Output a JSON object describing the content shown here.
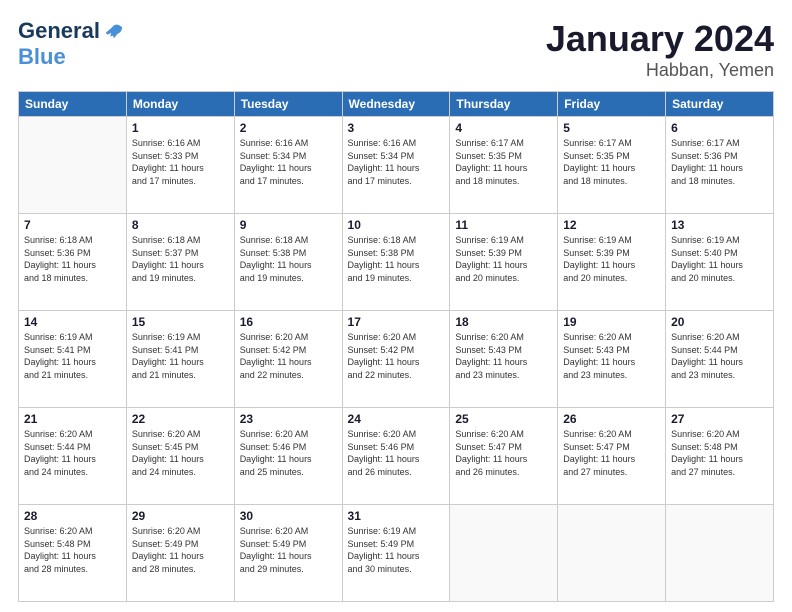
{
  "header": {
    "logo": {
      "general": "General",
      "blue": "Blue"
    },
    "title": "January 2024",
    "location": "Habban, Yemen"
  },
  "calendar": {
    "days_of_week": [
      "Sunday",
      "Monday",
      "Tuesday",
      "Wednesday",
      "Thursday",
      "Friday",
      "Saturday"
    ],
    "weeks": [
      [
        {
          "day": "",
          "info": ""
        },
        {
          "day": "1",
          "info": "Sunrise: 6:16 AM\nSunset: 5:33 PM\nDaylight: 11 hours\nand 17 minutes."
        },
        {
          "day": "2",
          "info": "Sunrise: 6:16 AM\nSunset: 5:34 PM\nDaylight: 11 hours\nand 17 minutes."
        },
        {
          "day": "3",
          "info": "Sunrise: 6:16 AM\nSunset: 5:34 PM\nDaylight: 11 hours\nand 17 minutes."
        },
        {
          "day": "4",
          "info": "Sunrise: 6:17 AM\nSunset: 5:35 PM\nDaylight: 11 hours\nand 18 minutes."
        },
        {
          "day": "5",
          "info": "Sunrise: 6:17 AM\nSunset: 5:35 PM\nDaylight: 11 hours\nand 18 minutes."
        },
        {
          "day": "6",
          "info": "Sunrise: 6:17 AM\nSunset: 5:36 PM\nDaylight: 11 hours\nand 18 minutes."
        }
      ],
      [
        {
          "day": "7",
          "info": "Sunrise: 6:18 AM\nSunset: 5:36 PM\nDaylight: 11 hours\nand 18 minutes."
        },
        {
          "day": "8",
          "info": "Sunrise: 6:18 AM\nSunset: 5:37 PM\nDaylight: 11 hours\nand 19 minutes."
        },
        {
          "day": "9",
          "info": "Sunrise: 6:18 AM\nSunset: 5:38 PM\nDaylight: 11 hours\nand 19 minutes."
        },
        {
          "day": "10",
          "info": "Sunrise: 6:18 AM\nSunset: 5:38 PM\nDaylight: 11 hours\nand 19 minutes."
        },
        {
          "day": "11",
          "info": "Sunrise: 6:19 AM\nSunset: 5:39 PM\nDaylight: 11 hours\nand 20 minutes."
        },
        {
          "day": "12",
          "info": "Sunrise: 6:19 AM\nSunset: 5:39 PM\nDaylight: 11 hours\nand 20 minutes."
        },
        {
          "day": "13",
          "info": "Sunrise: 6:19 AM\nSunset: 5:40 PM\nDaylight: 11 hours\nand 20 minutes."
        }
      ],
      [
        {
          "day": "14",
          "info": "Sunrise: 6:19 AM\nSunset: 5:41 PM\nDaylight: 11 hours\nand 21 minutes."
        },
        {
          "day": "15",
          "info": "Sunrise: 6:19 AM\nSunset: 5:41 PM\nDaylight: 11 hours\nand 21 minutes."
        },
        {
          "day": "16",
          "info": "Sunrise: 6:20 AM\nSunset: 5:42 PM\nDaylight: 11 hours\nand 22 minutes."
        },
        {
          "day": "17",
          "info": "Sunrise: 6:20 AM\nSunset: 5:42 PM\nDaylight: 11 hours\nand 22 minutes."
        },
        {
          "day": "18",
          "info": "Sunrise: 6:20 AM\nSunset: 5:43 PM\nDaylight: 11 hours\nand 23 minutes."
        },
        {
          "day": "19",
          "info": "Sunrise: 6:20 AM\nSunset: 5:43 PM\nDaylight: 11 hours\nand 23 minutes."
        },
        {
          "day": "20",
          "info": "Sunrise: 6:20 AM\nSunset: 5:44 PM\nDaylight: 11 hours\nand 23 minutes."
        }
      ],
      [
        {
          "day": "21",
          "info": "Sunrise: 6:20 AM\nSunset: 5:44 PM\nDaylight: 11 hours\nand 24 minutes."
        },
        {
          "day": "22",
          "info": "Sunrise: 6:20 AM\nSunset: 5:45 PM\nDaylight: 11 hours\nand 24 minutes."
        },
        {
          "day": "23",
          "info": "Sunrise: 6:20 AM\nSunset: 5:46 PM\nDaylight: 11 hours\nand 25 minutes."
        },
        {
          "day": "24",
          "info": "Sunrise: 6:20 AM\nSunset: 5:46 PM\nDaylight: 11 hours\nand 26 minutes."
        },
        {
          "day": "25",
          "info": "Sunrise: 6:20 AM\nSunset: 5:47 PM\nDaylight: 11 hours\nand 26 minutes."
        },
        {
          "day": "26",
          "info": "Sunrise: 6:20 AM\nSunset: 5:47 PM\nDaylight: 11 hours\nand 27 minutes."
        },
        {
          "day": "27",
          "info": "Sunrise: 6:20 AM\nSunset: 5:48 PM\nDaylight: 11 hours\nand 27 minutes."
        }
      ],
      [
        {
          "day": "28",
          "info": "Sunrise: 6:20 AM\nSunset: 5:48 PM\nDaylight: 11 hours\nand 28 minutes."
        },
        {
          "day": "29",
          "info": "Sunrise: 6:20 AM\nSunset: 5:49 PM\nDaylight: 11 hours\nand 28 minutes."
        },
        {
          "day": "30",
          "info": "Sunrise: 6:20 AM\nSunset: 5:49 PM\nDaylight: 11 hours\nand 29 minutes."
        },
        {
          "day": "31",
          "info": "Sunrise: 6:19 AM\nSunset: 5:49 PM\nDaylight: 11 hours\nand 30 minutes."
        },
        {
          "day": "",
          "info": ""
        },
        {
          "day": "",
          "info": ""
        },
        {
          "day": "",
          "info": ""
        }
      ]
    ]
  }
}
